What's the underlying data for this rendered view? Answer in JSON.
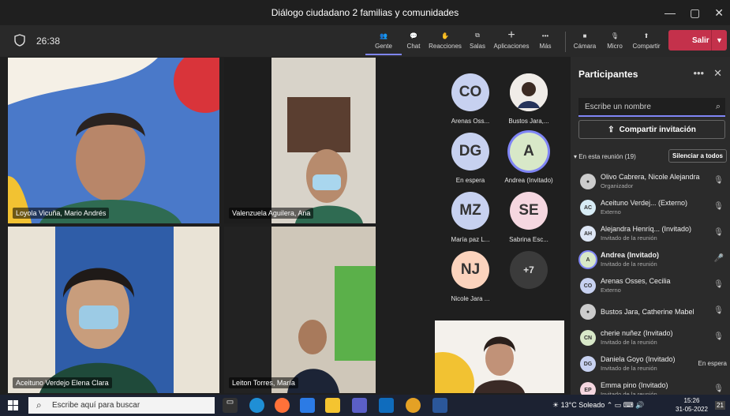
{
  "window": {
    "title": "Diálogo ciudadano 2 familias y comunidades"
  },
  "toolbar": {
    "timer": "26:38",
    "buttons": [
      {
        "label": "Gente",
        "icon": "people-icon"
      },
      {
        "label": "Chat",
        "icon": "chat-icon"
      },
      {
        "label": "Reacciones",
        "icon": "reactions-icon"
      },
      {
        "label": "Salas",
        "icon": "rooms-icon"
      },
      {
        "label": "Aplicaciones",
        "icon": "apps-icon"
      },
      {
        "label": "Más",
        "icon": "more-icon"
      },
      {
        "label": "Cámara",
        "icon": "camera-icon"
      },
      {
        "label": "Micro",
        "icon": "mic-off-icon"
      },
      {
        "label": "Compartir",
        "icon": "share-icon"
      }
    ],
    "leave_label": "Salir"
  },
  "videos": [
    {
      "name": "Loyola Vicuña, Mario Andrés"
    },
    {
      "name": "Valenzuela Aguilera, Ana"
    },
    {
      "name": "Aceituno Verdejo Elena Clara"
    },
    {
      "name": "Leiton Torres, María"
    }
  ],
  "avatars": [
    {
      "initials": "CO",
      "name": "Arenas Oss...",
      "color": "#c7d1f0"
    },
    {
      "initials": "",
      "name": "Bustos Jara,...",
      "color": "#e8e0e0"
    },
    {
      "initials": "DG",
      "name": "En espera",
      "color": "#c7d1f0"
    },
    {
      "initials": "A",
      "name": "Andrea (Invitado)",
      "color": "#d8e8c8"
    },
    {
      "initials": "MZ",
      "name": "María paz L...",
      "color": "#c7d1f0"
    },
    {
      "initials": "SE",
      "name": "Sabrina Esc...",
      "color": "#f5d7e0"
    },
    {
      "initials": "NJ",
      "name": "Nicole Jara ...",
      "color": "#fbd3bd"
    },
    {
      "initials": "+7",
      "name": "",
      "color": "#3b3b3b"
    }
  ],
  "panel": {
    "title": "Participantes",
    "search_placeholder": "Escribe un nombre",
    "share_label": "Compartir invitación",
    "in_meeting": "En esta reunión (19)",
    "mute_all": "Silenciar a todos",
    "participants": [
      {
        "initials": "",
        "name": "Olivo Cabrera, Nicole Alejandra",
        "role": "Organizador",
        "status": "",
        "color": "#ccc"
      },
      {
        "initials": "AC",
        "name": "Aceituno Verdej...  (Externo)",
        "role": "Externo",
        "status": "",
        "color": "#d7ecf5"
      },
      {
        "initials": "AH",
        "name": "Alejandra Henríq... (Invitado)",
        "role": "Invitado de la reunión",
        "status": "",
        "color": "#dde6f5"
      },
      {
        "initials": "A",
        "name": "Andrea (Invitado)",
        "role": "Invitado de la reunión",
        "status": "",
        "color": "#d8e8c8"
      },
      {
        "initials": "CO",
        "name": "Arenas Osses, Cecilia",
        "role": "Externo",
        "status": "",
        "color": "#c7d1f0"
      },
      {
        "initials": "",
        "name": "Bustos Jara, Catherine Mabel",
        "role": "",
        "status": "",
        "color": "#ccc"
      },
      {
        "initials": "CN",
        "name": "cherie nuñez (Invitado)",
        "role": "Invitado de la reunión",
        "status": "",
        "color": "#d8e8c8"
      },
      {
        "initials": "DG",
        "name": "Daniela Goyo (Invitado)",
        "role": "Invitado de la reunión",
        "status": "En espera",
        "color": "#c7d1f0"
      },
      {
        "initials": "EP",
        "name": "Emma pino (Invitado)",
        "role": "Invitado de la reunión",
        "status": "",
        "color": "#f5d7e0"
      }
    ]
  },
  "taskbar": {
    "search_placeholder": "Escribe aquí para buscar",
    "weather": "13°C  Soleado",
    "time": "15:26",
    "date": "31-05-2022",
    "badge": "21"
  }
}
